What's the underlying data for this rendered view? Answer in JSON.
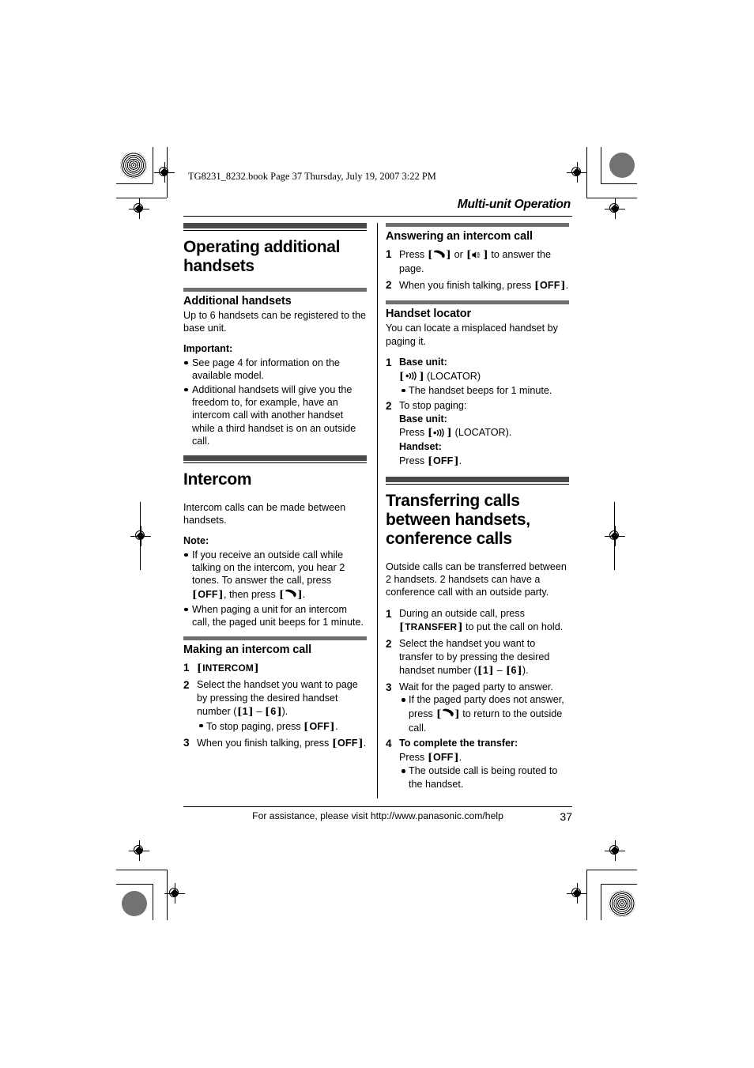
{
  "page_stamp": "TG8231_8232.book  Page 37  Thursday, July 19, 2007  3:22 PM",
  "running_head": "Multi-unit Operation",
  "footer": {
    "assistance": "For assistance, please visit http://www.panasonic.com/help",
    "page_number": "37"
  },
  "colors": {
    "h2_rule": "#4a4a4a",
    "h3_rule": "#6f6f6f",
    "text": "#000000",
    "background": "#ffffff"
  },
  "keys": {
    "off": "OFF",
    "intercom": "INTERCOM",
    "transfer": "TRANSFER",
    "one": "1",
    "six": "6",
    "locator_label": "(LOCATOR)",
    "locator_label_period": "(LOCATOR)."
  },
  "left_column": {
    "section1": {
      "title": "Operating additional handsets",
      "sub1": {
        "heading": "Additional handsets",
        "body": "Up to 6 handsets can be registered to the base unit.",
        "important_label": "Important:",
        "bullets": [
          "See page 4 for information on the available model.",
          "Additional handsets will give you the freedom to, for example, have an intercom call with another handset while a third handset is on an outside call."
        ]
      }
    },
    "section2": {
      "title": "Intercom",
      "body": "Intercom calls can be made between handsets.",
      "note_label": "Note:",
      "note_bullet_1_pre": "If you receive an outside call while talking on the intercom, you hear 2 tones. To answer the call, press ",
      "note_bullet_1_mid": ", then press ",
      "note_bullet_1_end": ".",
      "note_bullet_2": "When paging a unit for an intercom call, the paged unit beeps for 1 minute.",
      "sub1": {
        "heading": "Making an intercom call",
        "step2_pre": "Select the handset you want to page by pressing the desired handset number (",
        "step2_dash": " – ",
        "step2_post": ").",
        "step2_bullet_pre": "To stop paging, press ",
        "step2_bullet_post": ".",
        "step3_pre": "When you finish talking, press ",
        "step3_post": "."
      }
    }
  },
  "right_column": {
    "section1": {
      "heading": "Answering an intercom call",
      "step1_pre": "Press ",
      "step1_mid": " or ",
      "step1_post": " to answer the page.",
      "step2_pre": "When you finish talking, press ",
      "step2_post": "."
    },
    "section2": {
      "heading": "Handset locator",
      "body": "You can locate a misplaced handset by paging it.",
      "step1_label": "Base unit:",
      "step1_bullet": "The handset beeps for 1 minute.",
      "step2_intro": "To stop paging:",
      "step2_base_label": "Base unit:",
      "step2_base_press": "Press ",
      "step2_handset_label": "Handset:",
      "step2_handset_press": "Press ",
      "step2_handset_post": "."
    },
    "section3": {
      "title": "Transferring calls between handsets, conference calls",
      "body": "Outside calls can be transferred between 2 handsets. 2 handsets can have a conference call with an outside party.",
      "step1_pre": "During an outside call, press ",
      "step1_post": " to put the call on hold.",
      "step2_pre": "Select the handset you want to transfer to by pressing the desired handset number (",
      "step2_dash": " – ",
      "step2_post": ").",
      "step3": "Wait for the paged party to answer.",
      "step3_bullet_pre": "If the paged party does not answer, press ",
      "step3_bullet_post": " to return to the outside call.",
      "step4_label": "To complete the transfer:",
      "step4_press": "Press ",
      "step4_post": ".",
      "step4_bullet": "The outside call is being routed to the handset."
    }
  },
  "icons": {
    "talk": "telephone-handset-icon",
    "speakerphone": "speakerphone-icon",
    "locator": "locator-wave-icon"
  }
}
